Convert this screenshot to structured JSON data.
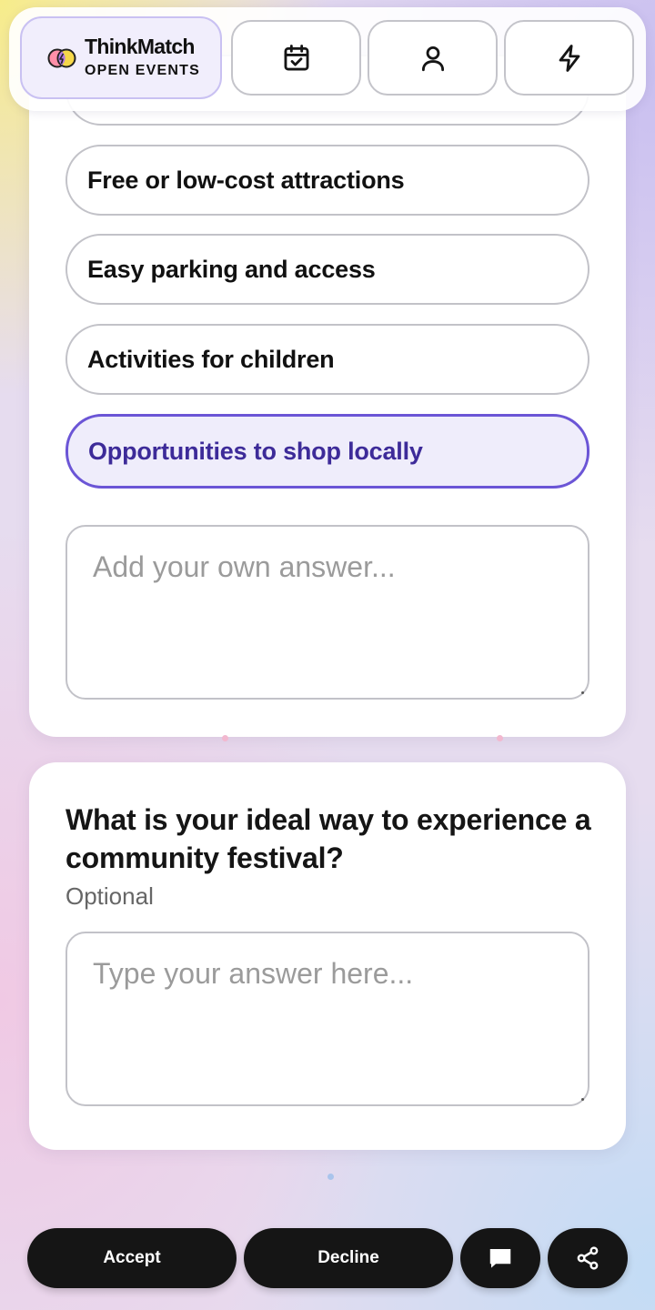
{
  "brand": {
    "title": "ThinkMatch",
    "subtitle": "OPEN EVENTS"
  },
  "nav": [
    {
      "icon": "calendar-check-icon"
    },
    {
      "icon": "user-icon"
    },
    {
      "icon": "lightning-icon"
    }
  ],
  "question1": {
    "options": [
      {
        "label": "",
        "selected": false
      },
      {
        "label": "Free or low-cost attractions",
        "selected": false
      },
      {
        "label": "Easy parking and access",
        "selected": false
      },
      {
        "label": "Activities for children",
        "selected": false
      },
      {
        "label": "Opportunities to shop locally",
        "selected": true
      }
    ],
    "custom_answer": {
      "placeholder": "Add your own answer...",
      "value": ""
    }
  },
  "question2": {
    "title": "What is your ideal way to experience a community festival?",
    "optional_label": "Optional",
    "answer": {
      "placeholder": "Type your answer here...",
      "value": ""
    }
  },
  "actions": {
    "accept_label": "Accept",
    "decline_label": "Decline",
    "chat_icon": "chat-bubble-icon",
    "share_icon": "share-icon"
  },
  "colors": {
    "accent": "#6b55d6",
    "accent_text": "#3d2b99",
    "selected_bg": "#efedfb",
    "button_bg": "#151515"
  }
}
